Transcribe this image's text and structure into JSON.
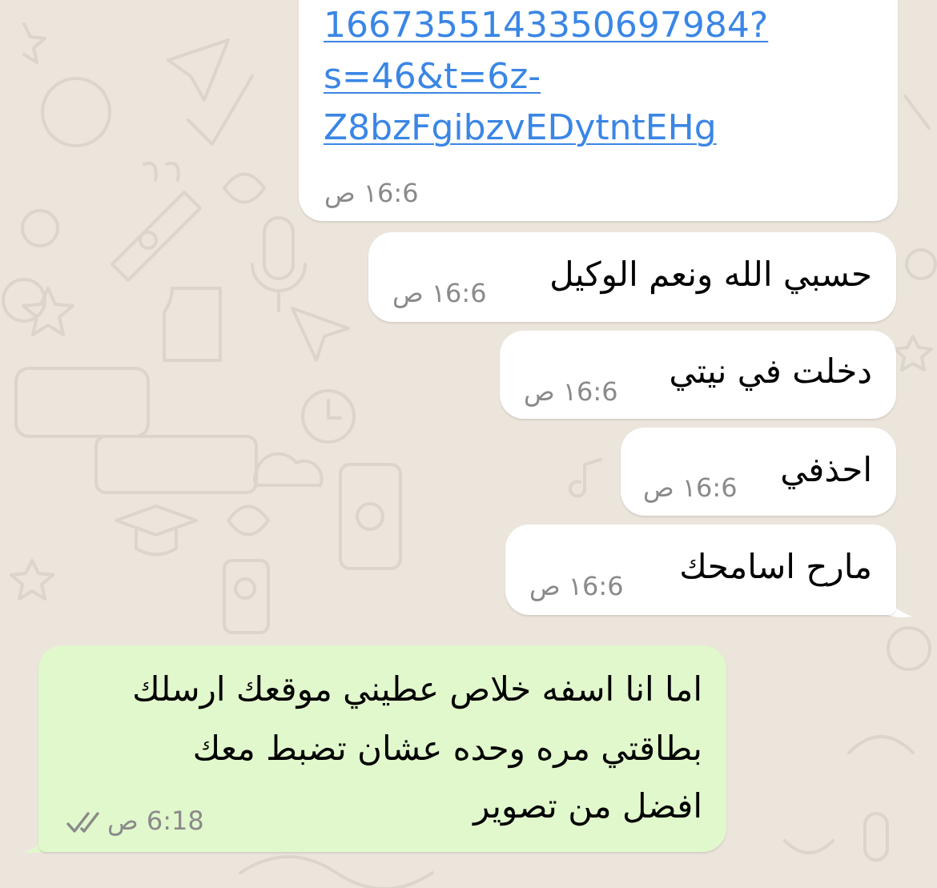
{
  "chat": {
    "colors": {
      "background": "#ece5dc",
      "incoming_bubble": "#ffffff",
      "outgoing_bubble": "#e1f8cc",
      "link": "#3a86e5",
      "timestamp": "#8a8a8a",
      "ticks": "#8a8a8a"
    },
    "messages": [
      {
        "direction": "incoming",
        "type": "link",
        "lines": [
          "1667355143350697984?",
          "s=46&t=6z-",
          "Z8bzFgibzvEDytntEHg"
        ],
        "time": "١6:6 ص"
      },
      {
        "direction": "incoming",
        "text": "حسبي الله ونعم الوكيل",
        "time": "١6:6 ص"
      },
      {
        "direction": "incoming",
        "text": "دخلت في نيتي",
        "time": "١6:6 ص"
      },
      {
        "direction": "incoming",
        "text": "احذفي",
        "time": "١6:6 ص"
      },
      {
        "direction": "incoming",
        "text": "مارح اسامحك",
        "time": "١6:6 ص"
      },
      {
        "direction": "outgoing",
        "lines": [
          "اما انا اسفه خلاص عطيني موقعك ارسلك",
          "بطاقتي مره وحده عشان تضبط معك",
          "افضل من تصوير"
        ],
        "time": "6:18 ص",
        "status_icon": "double-check-icon"
      }
    ]
  }
}
